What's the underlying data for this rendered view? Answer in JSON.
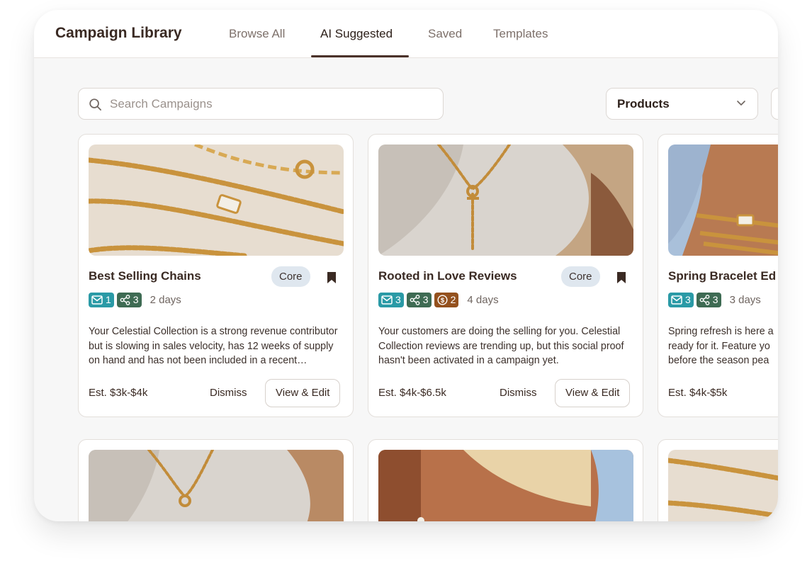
{
  "header": {
    "title": "Campaign Library",
    "tabs": [
      {
        "label": "Browse All",
        "active": false
      },
      {
        "label": "AI Suggested",
        "active": true
      },
      {
        "label": "Saved",
        "active": false
      },
      {
        "label": "Templates",
        "active": false
      }
    ]
  },
  "filters": {
    "search_placeholder": "Search Campaigns",
    "search_value": "",
    "products_label": "Products"
  },
  "cards": [
    {
      "title": "Best Selling Chains",
      "badge": "Core",
      "email_count": "1",
      "share_count": "3",
      "days": "2 days",
      "description": "Your Celestial Collection is a strong revenue contributor but is slowing in sales velocity, has 12 weeks of supply on hand and has not been included in a recent campaign.",
      "estimate": "Est. $3k-$4k",
      "dismiss_label": "Dismiss",
      "view_label": "View & Edit"
    },
    {
      "title": "Rooted in Love Reviews",
      "badge": "Core",
      "email_count": "3",
      "share_count": "3",
      "money_count": "2",
      "days": "4 days",
      "description": "Your customers are doing the selling for you. Celestial Collection reviews are trending up, but this social proof hasn't been activated in a campaign yet.",
      "estimate": "Est. $4k-$6.5k",
      "dismiss_label": "Dismiss",
      "view_label": "View & Edit"
    },
    {
      "title": "Spring Bracelet Ed",
      "badge": "",
      "email_count": "3",
      "share_count": "3",
      "days": "3 days",
      "description": "Spring refresh is here a ready for it. Feature yo before the season pea",
      "estimate": "Est. $4k-$5k",
      "dismiss_label": "",
      "view_label": ""
    }
  ],
  "colors": {
    "email_chip": "#2a9aa6",
    "share_chip": "#3e6b53",
    "money_chip": "#94511e",
    "core_badge": "#dfe7ef",
    "tab_underline": "#4a3129"
  }
}
